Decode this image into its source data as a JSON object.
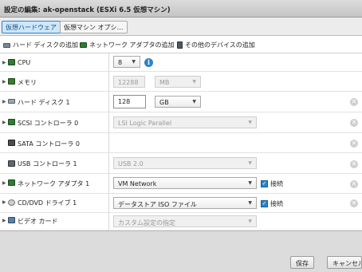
{
  "window": {
    "title": "設定の編集: ak-openstack (ESXi 6.5 仮想マシン)"
  },
  "tabs": [
    {
      "label": "仮想ハードウェア",
      "active": true
    },
    {
      "label": "仮想マシン オプシ…",
      "active": false
    }
  ],
  "toolbar": {
    "add_disk": "ハード ディスクの追加",
    "add_nic": "ネットワーク アダプタの追加",
    "add_other": "その他のデバイスの追加"
  },
  "hardware": {
    "cpu": {
      "label": "CPU",
      "value": "8"
    },
    "memory": {
      "label": "メモリ",
      "value": "12288",
      "unit": "MB"
    },
    "disk": {
      "label": "ハード ディスク 1",
      "value": "128",
      "unit": "GB"
    },
    "scsi": {
      "label": "SCSI コントローラ 0",
      "value": "LSI Logic Parallel"
    },
    "sata": {
      "label": "SATA コントローラ 0"
    },
    "usb": {
      "label": "USB コントローラ 1",
      "value": "USB 2.0"
    },
    "nic": {
      "label": "ネットワーク アダプタ 1",
      "value": "VM Network",
      "connect": "接続",
      "connected": true
    },
    "cdrom": {
      "label": "CD/DVD ドライブ 1",
      "value": "データストア ISO ファイル",
      "connect": "接続",
      "connected": true
    },
    "video": {
      "label": "ビデオ カード",
      "value": "カスタム設定の指定"
    }
  },
  "icons": {
    "expand": "▶",
    "caret": "▼",
    "remove": "✕",
    "info": "i",
    "check": "✓"
  },
  "colors": {
    "accent": "#2b84c9",
    "titlebar": "#c8c8c8",
    "footer": "#dcdcdc"
  },
  "footer": {
    "save": "保存",
    "cancel": "キャンセル"
  }
}
